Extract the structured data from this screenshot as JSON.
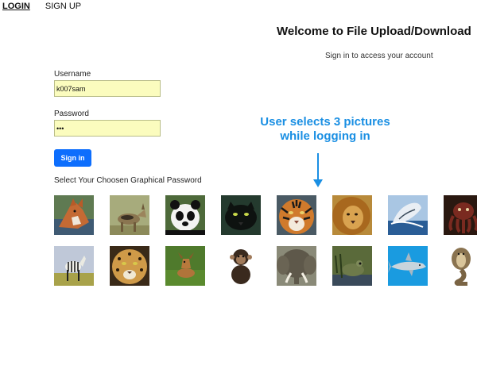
{
  "nav": {
    "login": "LOGIN",
    "signup": "SIGN UP"
  },
  "header": {
    "title": "Welcome to File Upload/Download",
    "subtitle": "Sign in to access your account"
  },
  "form": {
    "username_label": "Username",
    "username_value": "k007sam",
    "password_label": "Password",
    "password_value": "•••",
    "signin_label": "Sign in"
  },
  "graphical_password": {
    "label": "Select Your Choosen Graphical Password",
    "images": [
      {
        "name": "fox",
        "color": "#b8643a"
      },
      {
        "name": "jackal",
        "color": "#9c8a5e"
      },
      {
        "name": "panda",
        "color": "#f2f2f2"
      },
      {
        "name": "black-panther",
        "color": "#1d2a24"
      },
      {
        "name": "tiger",
        "color": "#c7742e"
      },
      {
        "name": "lion",
        "color": "#c98a2c"
      },
      {
        "name": "whale",
        "color": "#2c67a8"
      },
      {
        "name": "octopus",
        "color": "#5a1c16"
      },
      {
        "name": "zebra",
        "color": "#d9d4b8"
      },
      {
        "name": "leopard",
        "color": "#c69648"
      },
      {
        "name": "deer",
        "color": "#8a8a3a"
      },
      {
        "name": "chimpanzee",
        "color": "#3a2c22"
      },
      {
        "name": "elephant",
        "color": "#6d6656"
      },
      {
        "name": "frog",
        "color": "#5e6f3a"
      },
      {
        "name": "shark",
        "color": "#1f8fd6"
      },
      {
        "name": "cobra",
        "color": "#6a5a3e"
      }
    ]
  },
  "annotation": {
    "line1": "User selects 3 pictures",
    "line2": "while logging in",
    "color": "#1a8fe3"
  },
  "colors": {
    "primary_button": "#0d6efd",
    "input_bg": "#fbfcbe"
  }
}
